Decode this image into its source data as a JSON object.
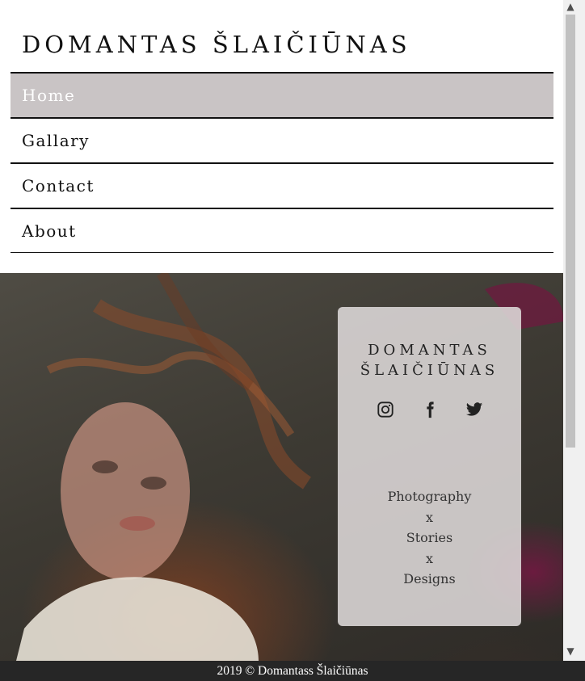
{
  "brand": {
    "name": "DOMANTAS ŠLAIČIŪNAS"
  },
  "nav": {
    "items": [
      {
        "label": "Home",
        "active": true
      },
      {
        "label": "Gallary",
        "active": false
      },
      {
        "label": "Contact",
        "active": false
      },
      {
        "label": "About",
        "active": false
      }
    ]
  },
  "hero": {
    "overlay": {
      "title_line1": "DOMANTAS",
      "title_line2": "ŠLAIČIŪNAS",
      "socials": [
        "instagram-icon",
        "facebook-icon",
        "twitter-icon"
      ],
      "tagline": [
        "Photography",
        "x",
        "Stories",
        "x",
        "Designs"
      ]
    }
  },
  "footer": {
    "text": "2019 © Domantass Šlaičiūnas"
  },
  "colors": {
    "nav_active_bg": "#c9c4c5",
    "overlay_bg": "#dedada",
    "footer_bg": "#262626"
  }
}
